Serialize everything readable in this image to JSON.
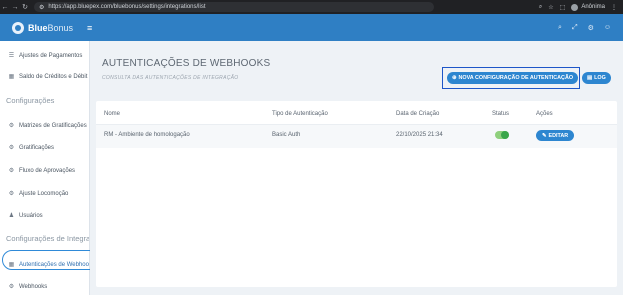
{
  "browser": {
    "url": "https://app.bluepex.com/bluebonus/settings/integrations/list",
    "profile_label": "Anônima"
  },
  "app": {
    "logo_text_bold": "Blue",
    "logo_text_rest": "Bonus"
  },
  "sidebar": {
    "items_top": [
      {
        "label": "Ajustes de Pagamentos",
        "icon": "list-icon"
      },
      {
        "label": "Saldo de Créditos e Débit",
        "icon": "table-icon"
      }
    ],
    "section_config": "Configurações",
    "items_config": [
      {
        "label": "Matrizes de Gratificações",
        "icon": "gears-icon"
      },
      {
        "label": "Gratificações",
        "icon": "gears-icon"
      },
      {
        "label": "Fluxo de Aprovações",
        "icon": "gears-icon"
      },
      {
        "label": "Ajuste Locomoção",
        "icon": "gears-icon"
      },
      {
        "label": "Usuários",
        "icon": "users-icon"
      }
    ],
    "section_integration": "Configurações de Integraç",
    "items_integration": [
      {
        "label": "Autenticações de Webhoo",
        "icon": "table-icon",
        "active": true
      },
      {
        "label": "Webhooks",
        "icon": "gears-icon"
      }
    ]
  },
  "main": {
    "title": "AUTENTICAÇÕES DE WEBHOOKS",
    "subtitle": "CONSULTA DAS AUTENTICAÇÕES DE INTEGRAÇÃO",
    "new_button_label": "NOVA CONFIGURAÇÃO DE AUTENTICAÇÃO",
    "log_button_label": "LOG",
    "table": {
      "headers": [
        "Nome",
        "Tipo de Autenticação",
        "Data de Criação",
        "Status",
        "Ações"
      ],
      "rows": [
        {
          "name": "RM - Ambiente de homologação",
          "auth_type": "Basic Auth",
          "created": "22/10/2025 21:34",
          "status": true,
          "action_label": "EDITAR"
        }
      ]
    }
  },
  "colors": {
    "brand": "#2f7fc4",
    "button": "#2d86d0",
    "highlight": "#1e56c8",
    "status_on": "#3aa64a"
  }
}
